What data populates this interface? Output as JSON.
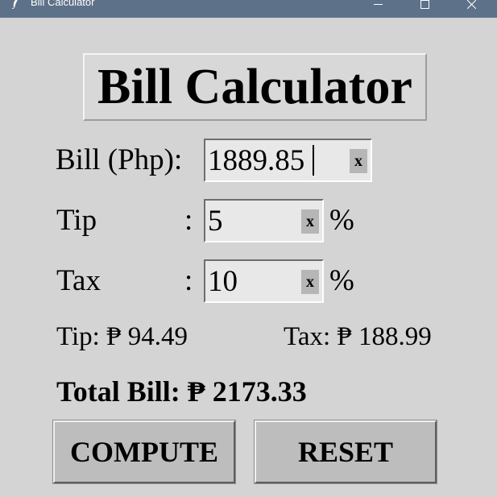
{
  "window": {
    "title": "Bill Calculator",
    "titlebar_color": "#5d7189",
    "background_color": "#d4d4d4"
  },
  "heading": "Bill Calculator",
  "form": {
    "bill": {
      "label": "Bill (Php):",
      "value": "1889.85",
      "clear_label": "x"
    },
    "tip": {
      "label": "Tip",
      "colon": ":",
      "value": "5",
      "clear_label": "x",
      "unit": "%"
    },
    "tax": {
      "label": "Tax",
      "colon": ":",
      "value": "10",
      "clear_label": "x",
      "unit": "%"
    }
  },
  "results": {
    "tip_text": "Tip: ₱ 94.49",
    "tax_text": "Tax: ₱ 188.99",
    "total_text": "Total Bill: ₱ 2173.33"
  },
  "buttons": {
    "compute_label": "COMPUTE",
    "reset_label": "RESET"
  },
  "icons": {
    "app": "feather-icon",
    "minimize": "minimize-icon",
    "maximize": "maximize-icon",
    "close": "close-icon"
  }
}
